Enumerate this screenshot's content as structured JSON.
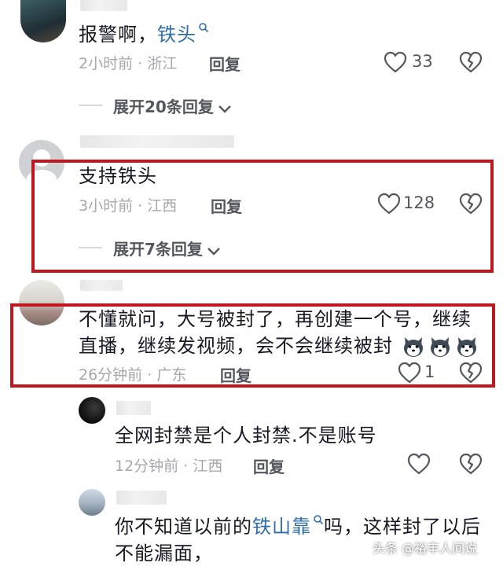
{
  "comments": [
    {
      "text_prefix": "报警啊，",
      "mention": "铁头",
      "time": "2小时前",
      "sep": "·",
      "location": "浙江",
      "reply": "回复",
      "likes": "33",
      "expand": "展开20条回复"
    },
    {
      "text": "支持铁头",
      "time": "3小时前",
      "sep": "·",
      "location": "江西",
      "reply": "回复",
      "likes": "128",
      "expand": "展开7条回复"
    },
    {
      "text_line1": "不懂就问，大号被封了，再创建一个号，继续",
      "text_line2": "直播，继续发视频，会不会继续被封",
      "time": "26分钟前",
      "sep": "·",
      "location": "广东",
      "reply": "回复",
      "likes": "1"
    }
  ],
  "replies": [
    {
      "text": "全网封禁是个人封禁.不是账号",
      "time": "12分钟前",
      "sep": "·",
      "location": "江西",
      "reply": "回复"
    },
    {
      "text_prefix": "你不知道以前的",
      "mention": "铁山靠",
      "text_suffix": "吗，这样封了以后",
      "text_line2": "不能漏面，"
    }
  ],
  "watermark": "头条 @裕丰人间说",
  "colors": {
    "highlight_box": "#c0171e",
    "mention": "#2f6ea8"
  },
  "icons": [
    "heart-icon",
    "broken-heart-icon",
    "chevron-down-icon",
    "search-icon",
    "husky-emoji"
  ]
}
